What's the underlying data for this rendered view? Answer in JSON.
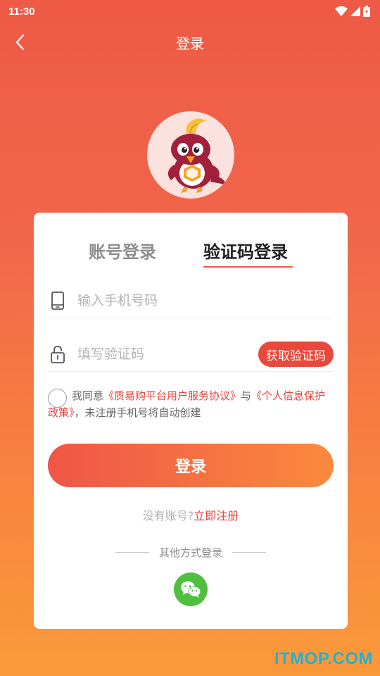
{
  "status_bar": {
    "time": "11:30"
  },
  "nav": {
    "title": "登录"
  },
  "tabs": [
    {
      "label": "账号登录",
      "active": false
    },
    {
      "label": "验证码登录",
      "active": true
    }
  ],
  "form": {
    "phone_placeholder": "输入手机号码",
    "phone_value": "",
    "code_placeholder": "填写验证码",
    "code_value": "",
    "get_code_label": "获取验证码"
  },
  "agreement": {
    "checked": false,
    "prefix": "我同意",
    "link1": "《质易购平台用户服务协议》",
    "middle": "与",
    "link2": "《个人信息保护政策》",
    "suffix": "，未注册手机号将自动创建"
  },
  "login_button": "登录",
  "register": {
    "prompt": "没有账号?",
    "link": "立即注册"
  },
  "other_login": {
    "label": "其他方式登录",
    "icons": [
      "wechat-icon"
    ]
  },
  "icons": {
    "back": "chevron-left-icon",
    "phone": "phone-icon",
    "lock": "lock-icon",
    "wifi": "wifi-icon",
    "signal": "signal-icon",
    "battery": "battery-icon"
  },
  "colors": {
    "accent": "#e7493d",
    "gradient_start": "#ef5547",
    "gradient_end": "#fb8a3d",
    "wechat": "#4fbf40"
  },
  "watermark": "ITMOP.COM"
}
